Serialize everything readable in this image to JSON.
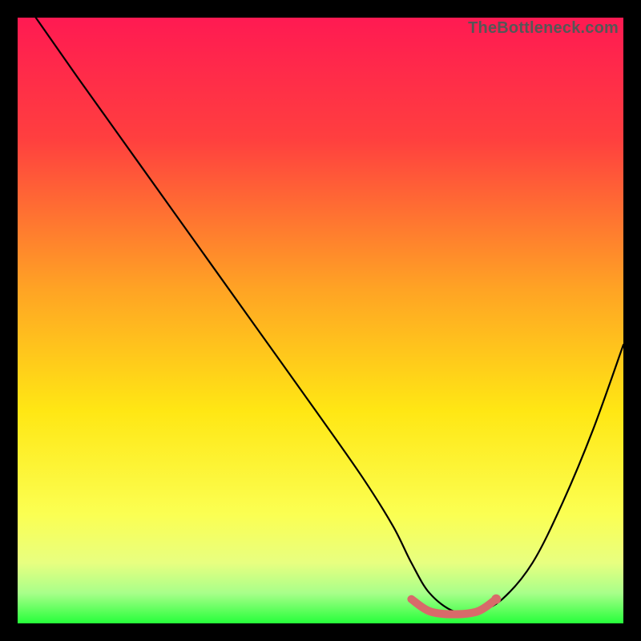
{
  "watermark": "TheBottleneck.com",
  "chart_data": {
    "type": "line",
    "title": "",
    "xlabel": "",
    "ylabel": "",
    "xlim": [
      0,
      100
    ],
    "ylim": [
      0,
      100
    ],
    "series": [
      {
        "name": "curve",
        "x": [
          3,
          10,
          20,
          30,
          40,
          50,
          57,
          62,
          65,
          68,
          72,
          76,
          80,
          85,
          90,
          95,
          100
        ],
        "y": [
          100,
          90,
          76,
          62,
          48,
          34,
          24,
          16,
          10,
          5,
          2,
          2,
          4,
          10,
          20,
          32,
          46
        ]
      },
      {
        "name": "bottom-mark",
        "x": [
          65,
          68,
          72,
          76,
          79
        ],
        "y": [
          4,
          2,
          1.5,
          2,
          4
        ]
      }
    ],
    "gradient_stops": [
      {
        "offset": 0,
        "color": "#ff1a52"
      },
      {
        "offset": 20,
        "color": "#ff3f3f"
      },
      {
        "offset": 45,
        "color": "#ffa424"
      },
      {
        "offset": 65,
        "color": "#ffe714"
      },
      {
        "offset": 82,
        "color": "#fbff52"
      },
      {
        "offset": 90,
        "color": "#e8ff80"
      },
      {
        "offset": 95,
        "color": "#a8ff8a"
      },
      {
        "offset": 100,
        "color": "#26ff3a"
      }
    ],
    "curve_color": "#000000",
    "mark_color": "#d86a6a"
  }
}
